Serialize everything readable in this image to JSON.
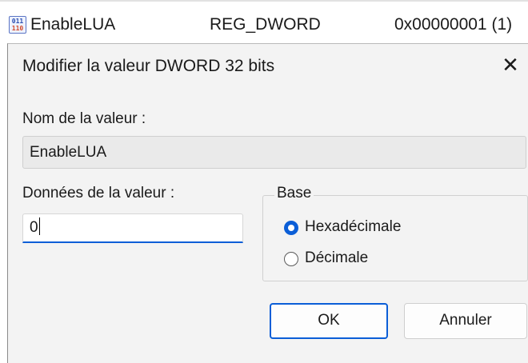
{
  "registry_row": {
    "icon": "registry-dword-icon",
    "name": "EnableLUA",
    "type": "REG_DWORD",
    "value": "0x00000001 (1)"
  },
  "dialog": {
    "title": "Modifier la valeur DWORD 32 bits",
    "close_icon": "close-icon",
    "value_name_label": "Nom de la valeur :",
    "value_name": "EnableLUA",
    "value_data_label": "Données de la valeur :",
    "value_data": "0",
    "base": {
      "legend": "Base",
      "options": [
        {
          "label": "Hexadécimale",
          "selected": true
        },
        {
          "label": "Décimale",
          "selected": false
        }
      ]
    },
    "buttons": {
      "ok": "OK",
      "cancel": "Annuler"
    },
    "accent_color": "#0b5ed7"
  }
}
